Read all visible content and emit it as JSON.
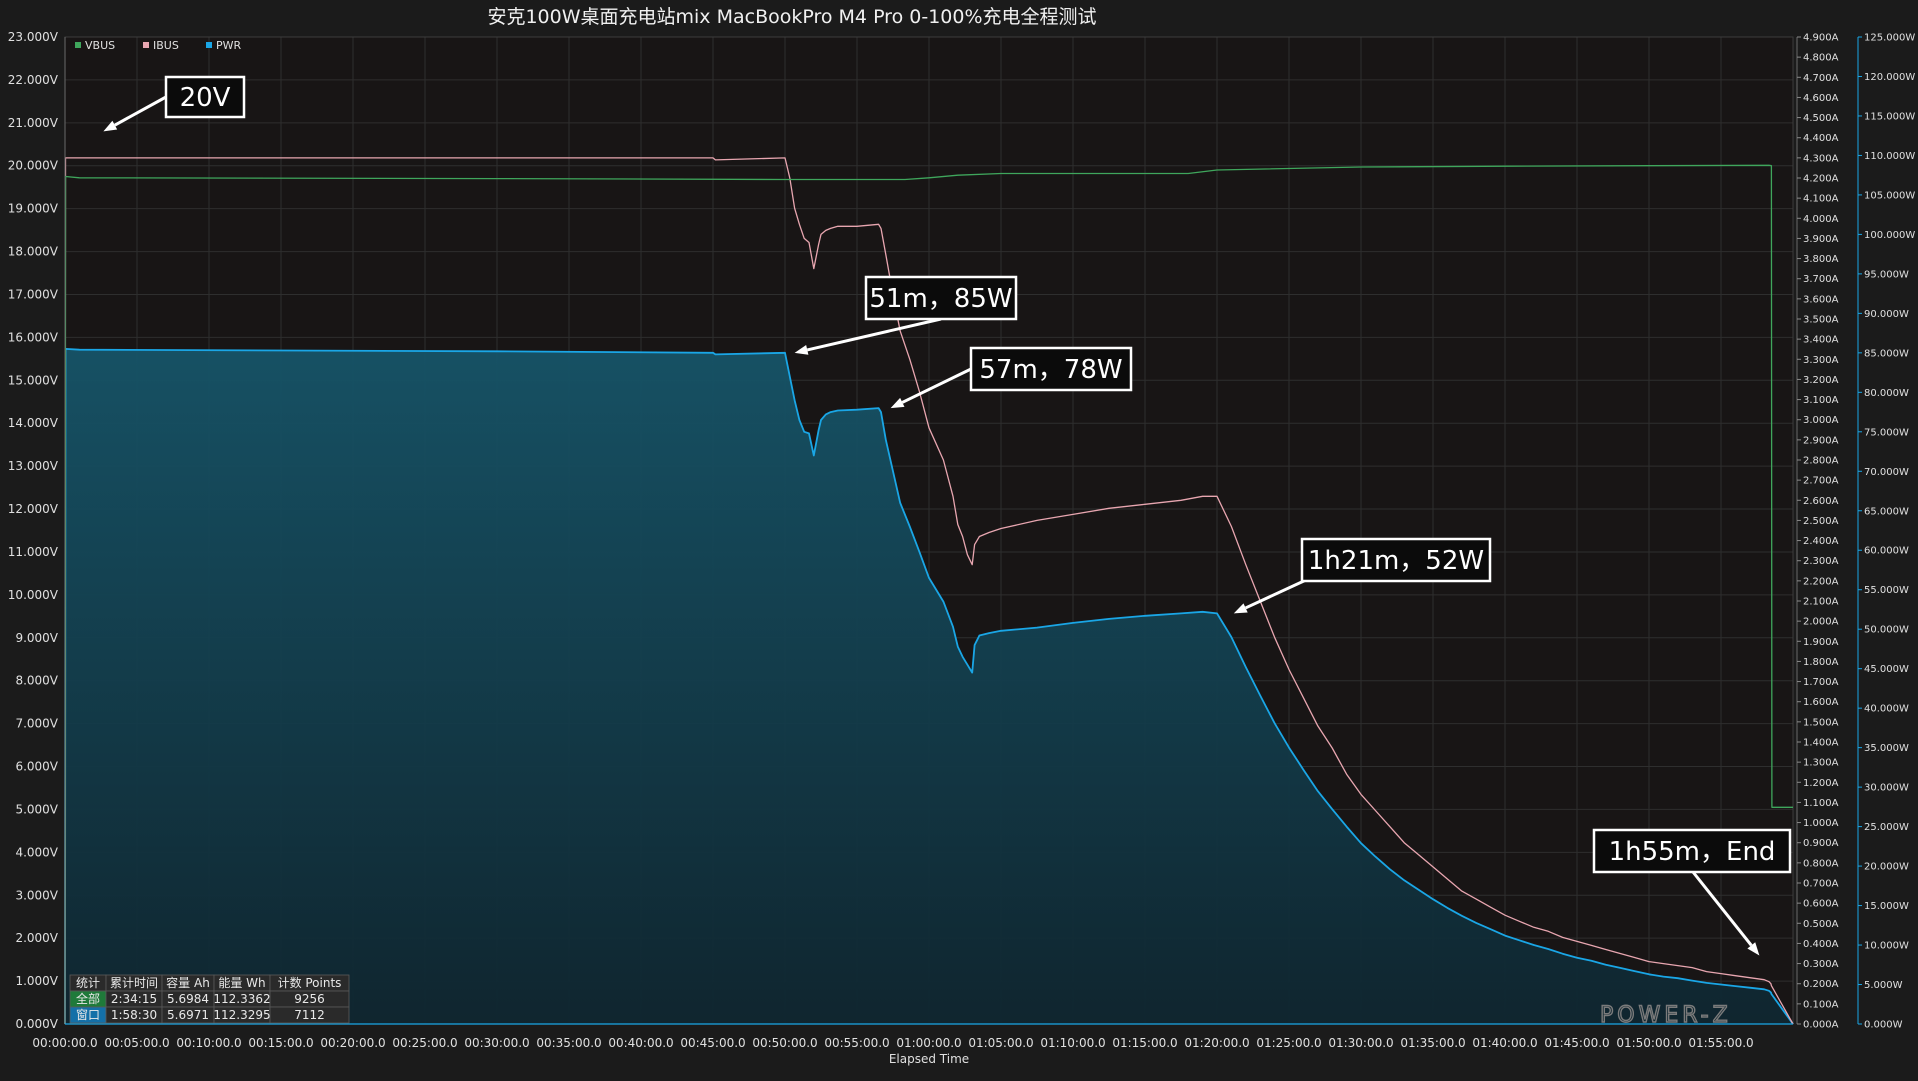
{
  "chart_data": {
    "type": "line",
    "title": "安克100W桌面充电站mix MacBookPro M4 Pro  0-100%充电全程测试",
    "xlabel": "Elapsed Time",
    "x_unit": "seconds",
    "xlim": [
      0,
      7200
    ],
    "x_ticks": [
      "00:00:00.0",
      "00:05:00.0",
      "00:10:00.0",
      "00:15:00.0",
      "00:20:00.0",
      "00:25:00.0",
      "00:30:00.0",
      "00:35:00.0",
      "00:40:00.0",
      "00:45:00.0",
      "00:50:00.0",
      "00:55:00.0",
      "01:00:00.0",
      "01:05:00.0",
      "01:10:00.0",
      "01:15:00.0",
      "01:20:00.0",
      "01:25:00.0",
      "01:30:00.0",
      "01:35:00.0",
      "01:40:00.0",
      "01:45:00.0",
      "01:50:00.0",
      "01:55:00.0"
    ],
    "axes": {
      "voltage": {
        "ylim": [
          0,
          23
        ],
        "ticks": [
          "0.000V",
          "1.000V",
          "2.000V",
          "3.000V",
          "4.000V",
          "5.000V",
          "6.000V",
          "7.000V",
          "8.000V",
          "9.000V",
          "10.000V",
          "11.000V",
          "12.000V",
          "13.000V",
          "14.000V",
          "15.000V",
          "16.000V",
          "17.000V",
          "18.000V",
          "19.000V",
          "20.000V",
          "21.000V",
          "22.000V",
          "23.000V"
        ]
      },
      "current": {
        "ylim": [
          0,
          4.9
        ],
        "ticks": [
          "0.000A",
          "0.100A",
          "0.200A",
          "0.300A",
          "0.400A",
          "0.500A",
          "0.600A",
          "0.700A",
          "0.800A",
          "0.900A",
          "1.000A",
          "1.100A",
          "1.200A",
          "1.300A",
          "1.400A",
          "1.500A",
          "1.600A",
          "1.700A",
          "1.800A",
          "1.900A",
          "2.000A",
          "2.100A",
          "2.200A",
          "2.300A",
          "2.400A",
          "2.500A",
          "2.600A",
          "2.700A",
          "2.800A",
          "2.900A",
          "3.000A",
          "3.100A",
          "3.200A",
          "3.300A",
          "3.400A",
          "3.500A",
          "3.600A",
          "3.700A",
          "3.800A",
          "3.900A",
          "4.000A",
          "4.100A",
          "4.200A",
          "4.300A",
          "4.400A",
          "4.500A",
          "4.600A",
          "4.700A",
          "4.800A",
          "4.900A"
        ]
      },
      "power": {
        "ylim": [
          0,
          125
        ],
        "ticks": [
          "0.000W",
          "5.000W",
          "10.000W",
          "15.000W",
          "20.000W",
          "25.000W",
          "30.000W",
          "35.000W",
          "40.000W",
          "45.000W",
          "50.000W",
          "55.000W",
          "60.000W",
          "65.000W",
          "70.000W",
          "75.000W",
          "80.000W",
          "85.000W",
          "90.000W",
          "95.000W",
          "100.000W",
          "105.000W",
          "110.000W",
          "115.000W",
          "120.000W",
          "125.000W"
        ]
      }
    },
    "legend": {
      "placement": "top-left",
      "entries": [
        "VBUS",
        "IBUS",
        "PWR"
      ]
    },
    "series": [
      {
        "name": "VBUS",
        "axis": "voltage",
        "color": "#3fa65c",
        "x": [
          0,
          2,
          60,
          1800,
          3000,
          3500,
          3600,
          3720,
          3900,
          4500,
          4680,
          4800,
          5400,
          6000,
          6600,
          7100,
          7110,
          7112,
          7200
        ],
        "y": [
          0,
          19.75,
          19.72,
          19.7,
          19.68,
          19.68,
          19.72,
          19.78,
          19.82,
          19.82,
          19.82,
          19.9,
          19.97,
          19.99,
          20.0,
          20.01,
          20.0,
          5.05,
          5.05
        ]
      },
      {
        "name": "IBUS",
        "axis": "current",
        "color": "#e8a6b0",
        "x": [
          0,
          2,
          60,
          1800,
          2700,
          2710,
          3000,
          3010,
          3020,
          3040,
          3060,
          3080,
          3100,
          3120,
          3140,
          3150,
          3170,
          3190,
          3220,
          3300,
          3390,
          3400,
          3420,
          3450,
          3480,
          3520,
          3560,
          3600,
          3660,
          3700,
          3720,
          3740,
          3760,
          3780,
          3790,
          3800,
          3810,
          3850,
          3900,
          4050,
          4200,
          4350,
          4500,
          4650,
          4740,
          4800,
          4860,
          4920,
          4980,
          5040,
          5100,
          5160,
          5220,
          5280,
          5340,
          5400,
          5460,
          5520,
          5580,
          5640,
          5700,
          5760,
          5820,
          5880,
          5940,
          6000,
          6060,
          6120,
          6180,
          6240,
          6300,
          6360,
          6420,
          6480,
          6540,
          6600,
          6660,
          6720,
          6780,
          6840,
          6900,
          6960,
          7020,
          7080,
          7100,
          7108,
          7110,
          7200
        ],
        "y": [
          0,
          4.3,
          4.3,
          4.3,
          4.3,
          4.29,
          4.3,
          4.25,
          4.2,
          4.05,
          3.97,
          3.9,
          3.88,
          3.75,
          3.87,
          3.92,
          3.94,
          3.95,
          3.96,
          3.96,
          3.97,
          3.95,
          3.82,
          3.62,
          3.44,
          3.3,
          3.14,
          2.96,
          2.8,
          2.62,
          2.48,
          2.42,
          2.33,
          2.28,
          2.38,
          2.4,
          2.42,
          2.44,
          2.46,
          2.5,
          2.53,
          2.56,
          2.58,
          2.6,
          2.62,
          2.62,
          2.47,
          2.28,
          2.1,
          1.92,
          1.76,
          1.62,
          1.48,
          1.37,
          1.24,
          1.14,
          1.06,
          0.98,
          0.9,
          0.84,
          0.78,
          0.72,
          0.66,
          0.62,
          0.58,
          0.54,
          0.51,
          0.48,
          0.46,
          0.43,
          0.41,
          0.39,
          0.37,
          0.35,
          0.33,
          0.31,
          0.3,
          0.29,
          0.28,
          0.26,
          0.25,
          0.24,
          0.23,
          0.22,
          0.21,
          0.2,
          0.19,
          0
        ]
      },
      {
        "name": "PWR",
        "axis": "power",
        "color": "#1aa6e6",
        "fill": true,
        "x": [
          0,
          2,
          60,
          1800,
          2700,
          2710,
          3000,
          3010,
          3020,
          3040,
          3060,
          3080,
          3100,
          3120,
          3140,
          3150,
          3170,
          3190,
          3220,
          3300,
          3390,
          3400,
          3420,
          3450,
          3480,
          3520,
          3560,
          3600,
          3660,
          3700,
          3720,
          3740,
          3760,
          3780,
          3790,
          3800,
          3810,
          3850,
          3900,
          4050,
          4200,
          4350,
          4500,
          4650,
          4740,
          4800,
          4860,
          4920,
          4980,
          5040,
          5100,
          5160,
          5220,
          5280,
          5340,
          5400,
          5460,
          5520,
          5580,
          5640,
          5700,
          5760,
          5820,
          5880,
          5940,
          6000,
          6060,
          6120,
          6180,
          6240,
          6300,
          6360,
          6420,
          6480,
          6540,
          6600,
          6660,
          6720,
          6780,
          6840,
          6900,
          6960,
          7020,
          7080,
          7100,
          7108,
          7110,
          7200
        ],
        "y": [
          0,
          85.5,
          85.4,
          85.2,
          85.0,
          84.8,
          85.0,
          83.5,
          82.0,
          79.0,
          76.5,
          75.0,
          74.8,
          72.0,
          75.2,
          76.5,
          77.2,
          77.5,
          77.7,
          77.8,
          78.0,
          77.5,
          74.0,
          70.0,
          66.0,
          63.0,
          59.8,
          56.5,
          53.5,
          50.3,
          47.8,
          46.5,
          45.5,
          44.5,
          48.0,
          48.6,
          49.2,
          49.5,
          49.8,
          50.2,
          50.8,
          51.3,
          51.7,
          52.0,
          52.2,
          52.0,
          49.0,
          45.2,
          41.6,
          38.1,
          35.0,
          32.2,
          29.5,
          27.2,
          25.0,
          22.9,
          21.2,
          19.6,
          18.2,
          17.0,
          15.8,
          14.7,
          13.7,
          12.8,
          12.0,
          11.2,
          10.6,
          10.0,
          9.5,
          8.9,
          8.4,
          8.0,
          7.5,
          7.1,
          6.7,
          6.3,
          6.0,
          5.8,
          5.5,
          5.2,
          5.0,
          4.8,
          4.6,
          4.4,
          4.2,
          4.0,
          3.8,
          0
        ]
      }
    ],
    "annotations": [
      {
        "text": "20V",
        "point": [
          160,
          20.8
        ],
        "axis": "voltage"
      },
      {
        "text": "51m，85W",
        "point": [
          3040,
          85
        ],
        "axis": "power"
      },
      {
        "text": "57m，78W",
        "point": [
          3440,
          78
        ],
        "axis": "power"
      },
      {
        "text": "1h21m，52W",
        "point": [
          4870,
          52
        ],
        "axis": "power"
      },
      {
        "text": "1h55m，End",
        "point": [
          7060,
          0.34
        ],
        "axis": "current"
      }
    ],
    "stats_table": {
      "headers": [
        "统计",
        "累计时间",
        "容量 Ah",
        "能量 Wh",
        "计数 Points"
      ],
      "rows": [
        [
          "全部",
          "2:34:15",
          "5.6984",
          "112.3362",
          "9256"
        ],
        [
          "窗口",
          "1:58:30",
          "5.6971",
          "112.3295",
          "7112"
        ]
      ]
    }
  },
  "logo_text": "POWER-Z",
  "colors": {
    "background": "#1b1b1b",
    "plot_background": "#181515",
    "grid": "#2e2e2e",
    "vbus": "#3fa65c",
    "ibus": "#e8a6b0",
    "pwr": "#1aa6e6",
    "pwr_fill_top": "#165468",
    "pwr_fill_bottom": "#0f2630"
  }
}
